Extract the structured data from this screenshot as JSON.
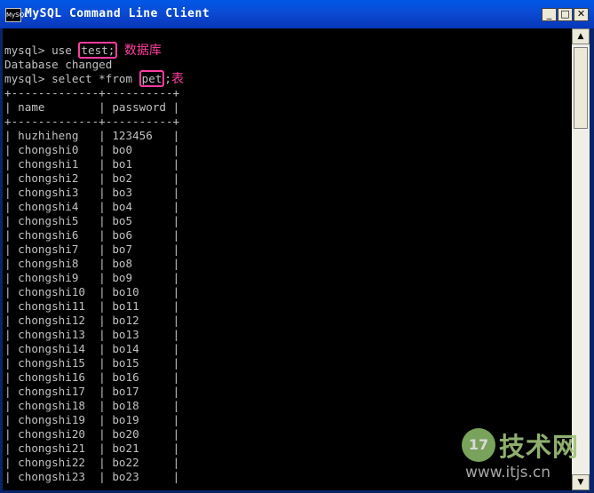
{
  "window": {
    "title": "MySQL Command Line Client",
    "icon_text": "MySQL",
    "buttons": {
      "minimize": "_",
      "maximize": "□",
      "close": "✕"
    }
  },
  "console": {
    "line1": {
      "prompt": "mysql> use ",
      "highlight": "test;",
      "annotation": "数据库"
    },
    "line2": "Database changed",
    "line3": {
      "prompt": "mysql> select *from ",
      "highlight": "pet",
      "after": ";",
      "annotation": "表"
    },
    "table": {
      "border": "+-------------+----------+",
      "headers": [
        "name",
        "password"
      ],
      "rows": [
        [
          "huzhiheng",
          "123456"
        ],
        [
          "chongshi0",
          "bo0"
        ],
        [
          "chongshi1",
          "bo1"
        ],
        [
          "chongshi2",
          "bo2"
        ],
        [
          "chongshi3",
          "bo3"
        ],
        [
          "chongshi4",
          "bo4"
        ],
        [
          "chongshi5",
          "bo5"
        ],
        [
          "chongshi6",
          "bo6"
        ],
        [
          "chongshi7",
          "bo7"
        ],
        [
          "chongshi8",
          "bo8"
        ],
        [
          "chongshi9",
          "bo9"
        ],
        [
          "chongshi10",
          "bo10"
        ],
        [
          "chongshi11",
          "bo11"
        ],
        [
          "chongshi12",
          "bo12"
        ],
        [
          "chongshi13",
          "bo13"
        ],
        [
          "chongshi14",
          "bo14"
        ],
        [
          "chongshi15",
          "bo15"
        ],
        [
          "chongshi16",
          "bo16"
        ],
        [
          "chongshi17",
          "bo17"
        ],
        [
          "chongshi18",
          "bo18"
        ],
        [
          "chongshi19",
          "bo19"
        ],
        [
          "chongshi20",
          "bo20"
        ],
        [
          "chongshi21",
          "bo21"
        ],
        [
          "chongshi22",
          "bo22"
        ],
        [
          "chongshi23",
          "bo23"
        ]
      ]
    }
  },
  "scrollbar": {
    "up_arrow": "▲",
    "down_arrow": "▼"
  },
  "watermark": {
    "logo_text": "17",
    "brand": "技术网",
    "url": "www.itjs.cn"
  },
  "colors": {
    "titlebar": "#0a4cd6",
    "console_bg": "#000000",
    "console_text": "#c0c0c0",
    "annotation": "#ff3da0"
  }
}
